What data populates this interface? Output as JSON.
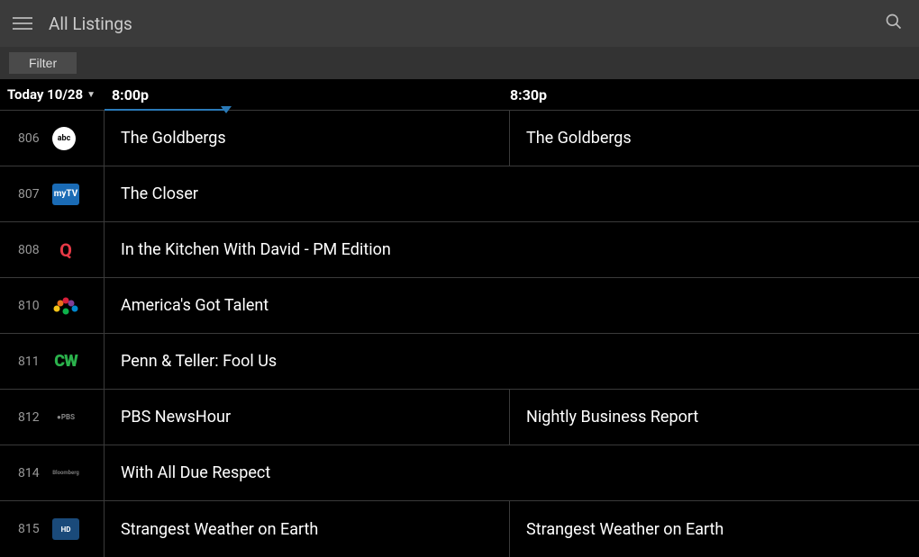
{
  "header": {
    "title": "All Listings"
  },
  "filter": {
    "label": "Filter"
  },
  "timebar": {
    "date": "Today 10/28",
    "slot1": "8:00p",
    "slot2": "8:30p"
  },
  "channels": [
    {
      "num": "806",
      "logo": "abc",
      "logoText": "abc",
      "programs": [
        {
          "title": "The Goldbergs",
          "span": "half"
        },
        {
          "title": "The Goldbergs",
          "span": "half"
        }
      ]
    },
    {
      "num": "807",
      "logo": "mytv",
      "logoText": "myTV",
      "programs": [
        {
          "title": "The Closer",
          "span": "full"
        }
      ]
    },
    {
      "num": "808",
      "logo": "q",
      "logoText": "Q",
      "programs": [
        {
          "title": "In the Kitchen With David - PM Edition",
          "span": "full"
        }
      ]
    },
    {
      "num": "810",
      "logo": "nbc",
      "logoText": "",
      "programs": [
        {
          "title": "America's Got Talent",
          "span": "full"
        }
      ]
    },
    {
      "num": "811",
      "logo": "cw",
      "logoText": "CW",
      "programs": [
        {
          "title": "Penn & Teller: Fool Us",
          "span": "full"
        }
      ]
    },
    {
      "num": "812",
      "logo": "pbs",
      "logoText": "●PBS",
      "programs": [
        {
          "title": "PBS NewsHour",
          "span": "half"
        },
        {
          "title": "Nightly Business Report",
          "span": "half"
        }
      ]
    },
    {
      "num": "814",
      "logo": "bloom",
      "logoText": "Bloomberg",
      "programs": [
        {
          "title": "With All Due Respect",
          "span": "full"
        }
      ]
    },
    {
      "num": "815",
      "logo": "hd",
      "logoText": "HD",
      "programs": [
        {
          "title": "Strangest Weather on Earth",
          "span": "half"
        },
        {
          "title": "Strangest Weather on Earth",
          "span": "half"
        }
      ]
    }
  ]
}
